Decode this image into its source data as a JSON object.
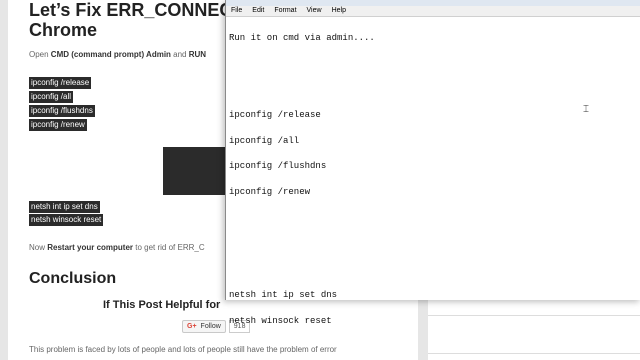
{
  "article": {
    "title_line1": "Let’s Fix ERR_CONNECTIO",
    "title_line2": "Chrome",
    "intro_prefix": "Open ",
    "intro_bold1": "CMD (command prompt) Admin",
    "intro_mid": " and ",
    "intro_bold2": "RUN",
    "commands_block1": [
      "ipconfig /release",
      "ipconfig /all",
      "ipconfig /flushdns",
      "ipconfig /renew"
    ],
    "commands_block2": [
      "netsh int ip set dns",
      "netsh winsock reset"
    ],
    "restart_prefix": "Now ",
    "restart_bold": "Restart your computer",
    "restart_suffix": " to get rid of ERR_C",
    "conclusion_heading": "Conclusion",
    "helpful_heading": "If This Post Helpful for",
    "follow_label": "Follow",
    "follow_count": "918",
    "bottom_text": "This problem is faced by lots of people and lots of people still have the problem of error"
  },
  "notepad": {
    "menu": [
      "File",
      "Edit",
      "Format",
      "View",
      "Help"
    ],
    "lines": [
      "Run it on cmd via admin....",
      "",
      "",
      "ipconfig /release",
      "ipconfig /all",
      "ipconfig /flushdns",
      "ipconfig /renew",
      "",
      "",
      "",
      "netsh int ip set dns",
      "netsh winsock reset"
    ]
  }
}
